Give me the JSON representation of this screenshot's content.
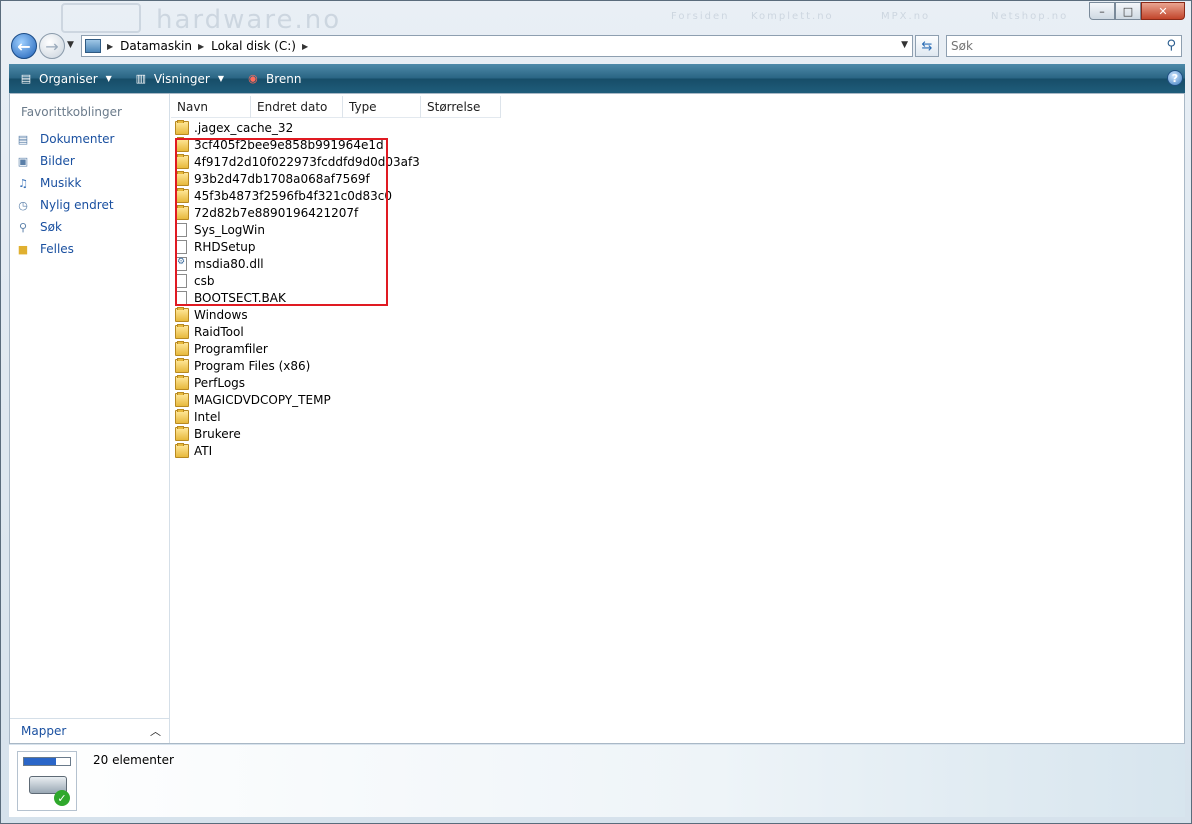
{
  "window": {
    "banner_brand": "hardware.no",
    "banner_nav": [
      "Forsiden",
      "Komplett.no",
      "MPX.no",
      "Netshop.no"
    ],
    "buttons": {
      "minimize": "–",
      "maximize": "□",
      "close": "✕"
    }
  },
  "address": {
    "crumbs": [
      "Datamaskin",
      "Lokal disk (C:)"
    ],
    "search_placeholder": "Søk"
  },
  "toolbar": {
    "items": [
      {
        "label": "Organiser",
        "icon": "organize-icon",
        "dropdown": true
      },
      {
        "label": "Visninger",
        "icon": "views-icon",
        "dropdown": true
      },
      {
        "label": "Brenn",
        "icon": "burn-icon",
        "dropdown": false
      }
    ],
    "help": "?"
  },
  "sidebar": {
    "heading": "Favorittkoblinger",
    "items": [
      {
        "label": "Dokumenter",
        "icon": "documents-icon"
      },
      {
        "label": "Bilder",
        "icon": "pictures-icon"
      },
      {
        "label": "Musikk",
        "icon": "music-icon"
      },
      {
        "label": "Nylig endret",
        "icon": "recent-icon"
      },
      {
        "label": "Søk",
        "icon": "search-icon"
      },
      {
        "label": "Felles",
        "icon": "public-folder-icon"
      }
    ],
    "folders_label": "Mapper"
  },
  "columns": [
    "Navn",
    "Endret dato",
    "Type",
    "Størrelse"
  ],
  "files": [
    {
      "name": ".jagex_cache_32",
      "kind": "folder"
    },
    {
      "name": "3cf405f2bee9e858b991964e1d",
      "kind": "folder"
    },
    {
      "name": "4f917d2d10f022973fcddfd9d0d03af3",
      "kind": "folder"
    },
    {
      "name": "93b2d47db1708a068af7569f",
      "kind": "folder"
    },
    {
      "name": "45f3b4873f2596fb4f321c0d83c0",
      "kind": "folder"
    },
    {
      "name": "72d82b7e8890196421207f",
      "kind": "folder"
    },
    {
      "name": "Sys_LogWin",
      "kind": "file"
    },
    {
      "name": "RHDSetup",
      "kind": "file"
    },
    {
      "name": "msdia80.dll",
      "kind": "dll"
    },
    {
      "name": "csb",
      "kind": "file"
    },
    {
      "name": "BOOTSECT.BAK",
      "kind": "file"
    },
    {
      "name": "Windows",
      "kind": "folder"
    },
    {
      "name": "RaidTool",
      "kind": "folder"
    },
    {
      "name": "Programfiler",
      "kind": "folder"
    },
    {
      "name": "Program Files (x86)",
      "kind": "folder"
    },
    {
      "name": "PerfLogs",
      "kind": "folder"
    },
    {
      "name": "MAGICDVDCOPY_TEMP",
      "kind": "folder"
    },
    {
      "name": "Intel",
      "kind": "folder"
    },
    {
      "name": "Brukere",
      "kind": "folder"
    },
    {
      "name": "ATI",
      "kind": "folder"
    }
  ],
  "details": {
    "item_count": "20 elementer"
  },
  "colors": {
    "highlight_box": "#e01a22",
    "link": "#1a50a0",
    "toolbar": "#2a6584"
  }
}
